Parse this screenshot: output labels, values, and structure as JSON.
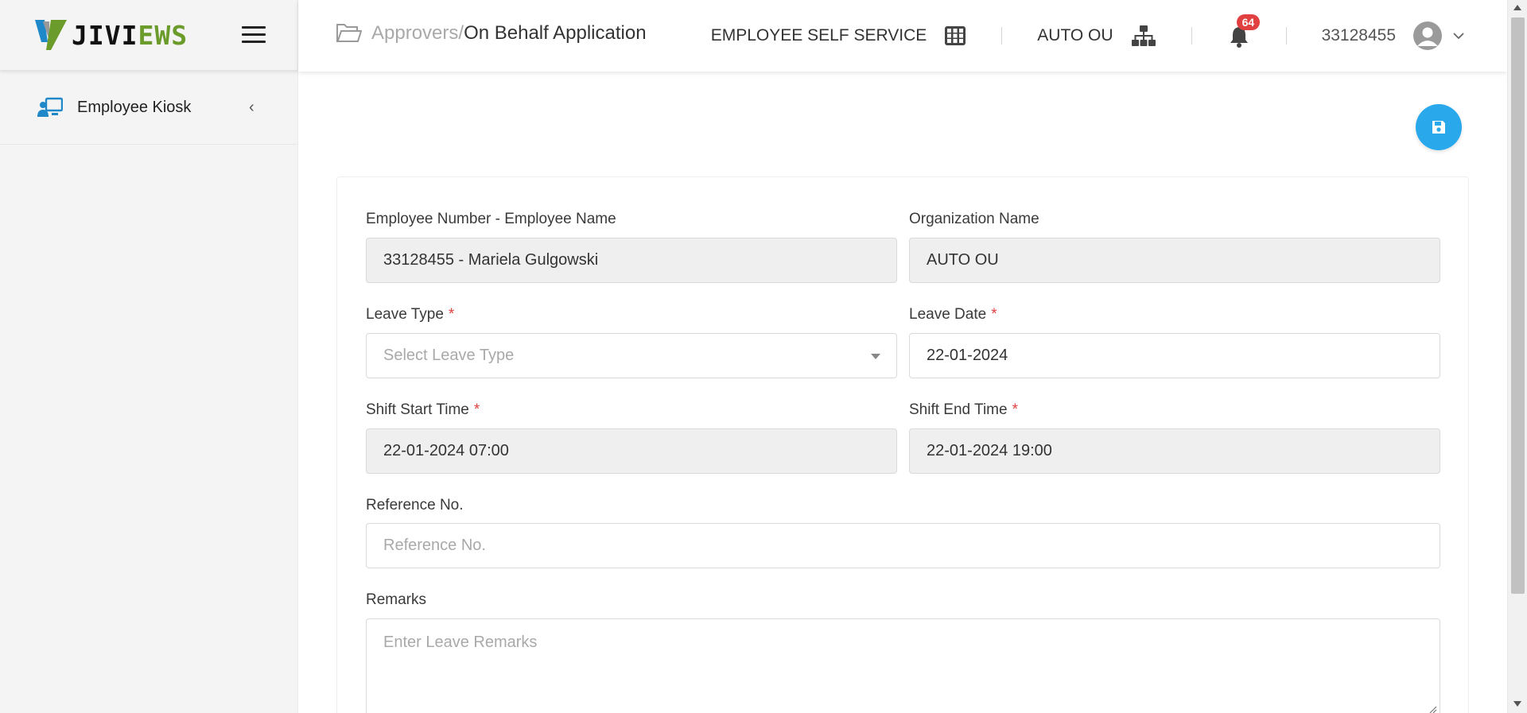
{
  "brand": {
    "logo_text_a": "JIVI",
    "logo_text_b": "EWS"
  },
  "sidebar": {
    "items": [
      {
        "label": "Employee Kiosk"
      }
    ]
  },
  "breadcrumb": {
    "parent": "Approvers/",
    "current": "On Behalf Application"
  },
  "topbar": {
    "module": "EMPLOYEE SELF SERVICE",
    "org_unit": "AUTO OU",
    "notifications_count": "64",
    "user_id": "33128455"
  },
  "form": {
    "employee": {
      "label": "Employee Number - Employee Name",
      "value": "33128455 - Mariela Gulgowski"
    },
    "organization": {
      "label": "Organization Name",
      "value": "AUTO OU"
    },
    "leave_type": {
      "label": "Leave Type",
      "required": "*",
      "placeholder": "Select Leave Type"
    },
    "leave_date": {
      "label": "Leave Date",
      "required": "*",
      "value": "22-01-2024"
    },
    "shift_start": {
      "label": "Shift Start Time",
      "required": "*",
      "value": "22-01-2024 07:00"
    },
    "shift_end": {
      "label": "Shift End Time",
      "required": "*",
      "value": "22-01-2024 19:00"
    },
    "reference": {
      "label": "Reference No.",
      "placeholder": "Reference No."
    },
    "remarks": {
      "label": "Remarks",
      "placeholder": "Enter Leave Remarks"
    }
  },
  "colors": {
    "accent": "#29a9ec",
    "brand_green": "#6b9b2a",
    "badge": "#e0403f",
    "required": "#e0403f"
  },
  "icons": [
    "folder-icon",
    "grid-icon",
    "org-chart-icon",
    "bell-icon",
    "user-avatar-icon",
    "chevron-down-icon",
    "save-icon",
    "kiosk-icon",
    "chevron-left-icon",
    "menu-icon"
  ]
}
